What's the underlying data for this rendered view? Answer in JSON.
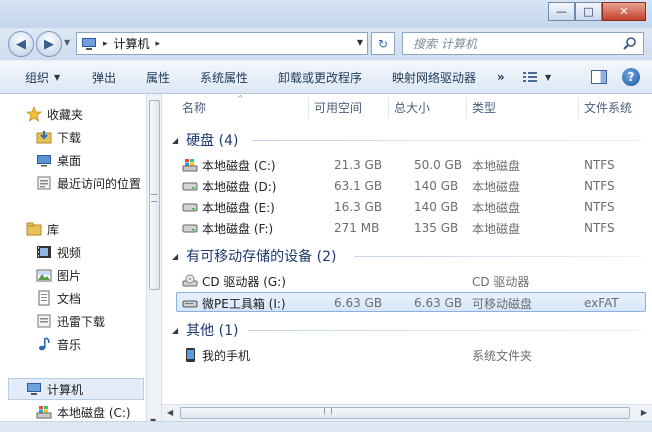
{
  "window": {
    "minimize_glyph": "—",
    "maximize_glyph": "□",
    "close_glyph": "✕"
  },
  "address": {
    "path_root": "计算机",
    "separator": "▸",
    "search_placeholder": "搜索 计算机"
  },
  "toolbar": {
    "organize": "组织",
    "eject": "弹出",
    "properties": "属性",
    "system_properties": "系统属性",
    "uninstall": "卸载或更改程序",
    "map_drive": "映射网络驱动器",
    "more": "»"
  },
  "navpane": {
    "favorites": "收藏夹",
    "downloads": "下载",
    "desktop": "桌面",
    "recent": "最近访问的位置",
    "libraries": "库",
    "videos": "视频",
    "pictures": "图片",
    "documents": "文档",
    "xunlei": "迅雷下载",
    "music": "音乐",
    "computer": "计算机",
    "local_c": "本地磁盘 (C:)"
  },
  "columns": {
    "name": "名称",
    "free": "可用空间",
    "total": "总大小",
    "type": "类型",
    "fs": "文件系统"
  },
  "groups": {
    "hdd": "硬盘 (4)",
    "removable": "有可移动存储的设备 (2)",
    "other": "其他 (1)"
  },
  "drives": [
    {
      "name": "本地磁盘 (C:)",
      "free": "21.3 GB",
      "total": "50.0 GB",
      "type": "本地磁盘",
      "fs": "NTFS"
    },
    {
      "name": "本地磁盘 (D:)",
      "free": "63.1 GB",
      "total": "140 GB",
      "type": "本地磁盘",
      "fs": "NTFS"
    },
    {
      "name": "本地磁盘 (E:)",
      "free": "16.3 GB",
      "total": "140 GB",
      "type": "本地磁盘",
      "fs": "NTFS"
    },
    {
      "name": "本地磁盘 (F:)",
      "free": "271 MB",
      "total": "135 GB",
      "type": "本地磁盘",
      "fs": "NTFS"
    }
  ],
  "removable": [
    {
      "name": "CD 驱动器 (G:)",
      "free": "",
      "total": "",
      "type": "CD 驱动器",
      "fs": ""
    },
    {
      "name": "微PE工具箱 (I:)",
      "free": "6.63 GB",
      "total": "6.63 GB",
      "type": "可移动磁盘",
      "fs": "exFAT"
    }
  ],
  "other": [
    {
      "name": "我的手机",
      "type": "系统文件夹"
    }
  ],
  "colors": {
    "accent": "#1e3a70",
    "selection": "#d6e6fa"
  }
}
